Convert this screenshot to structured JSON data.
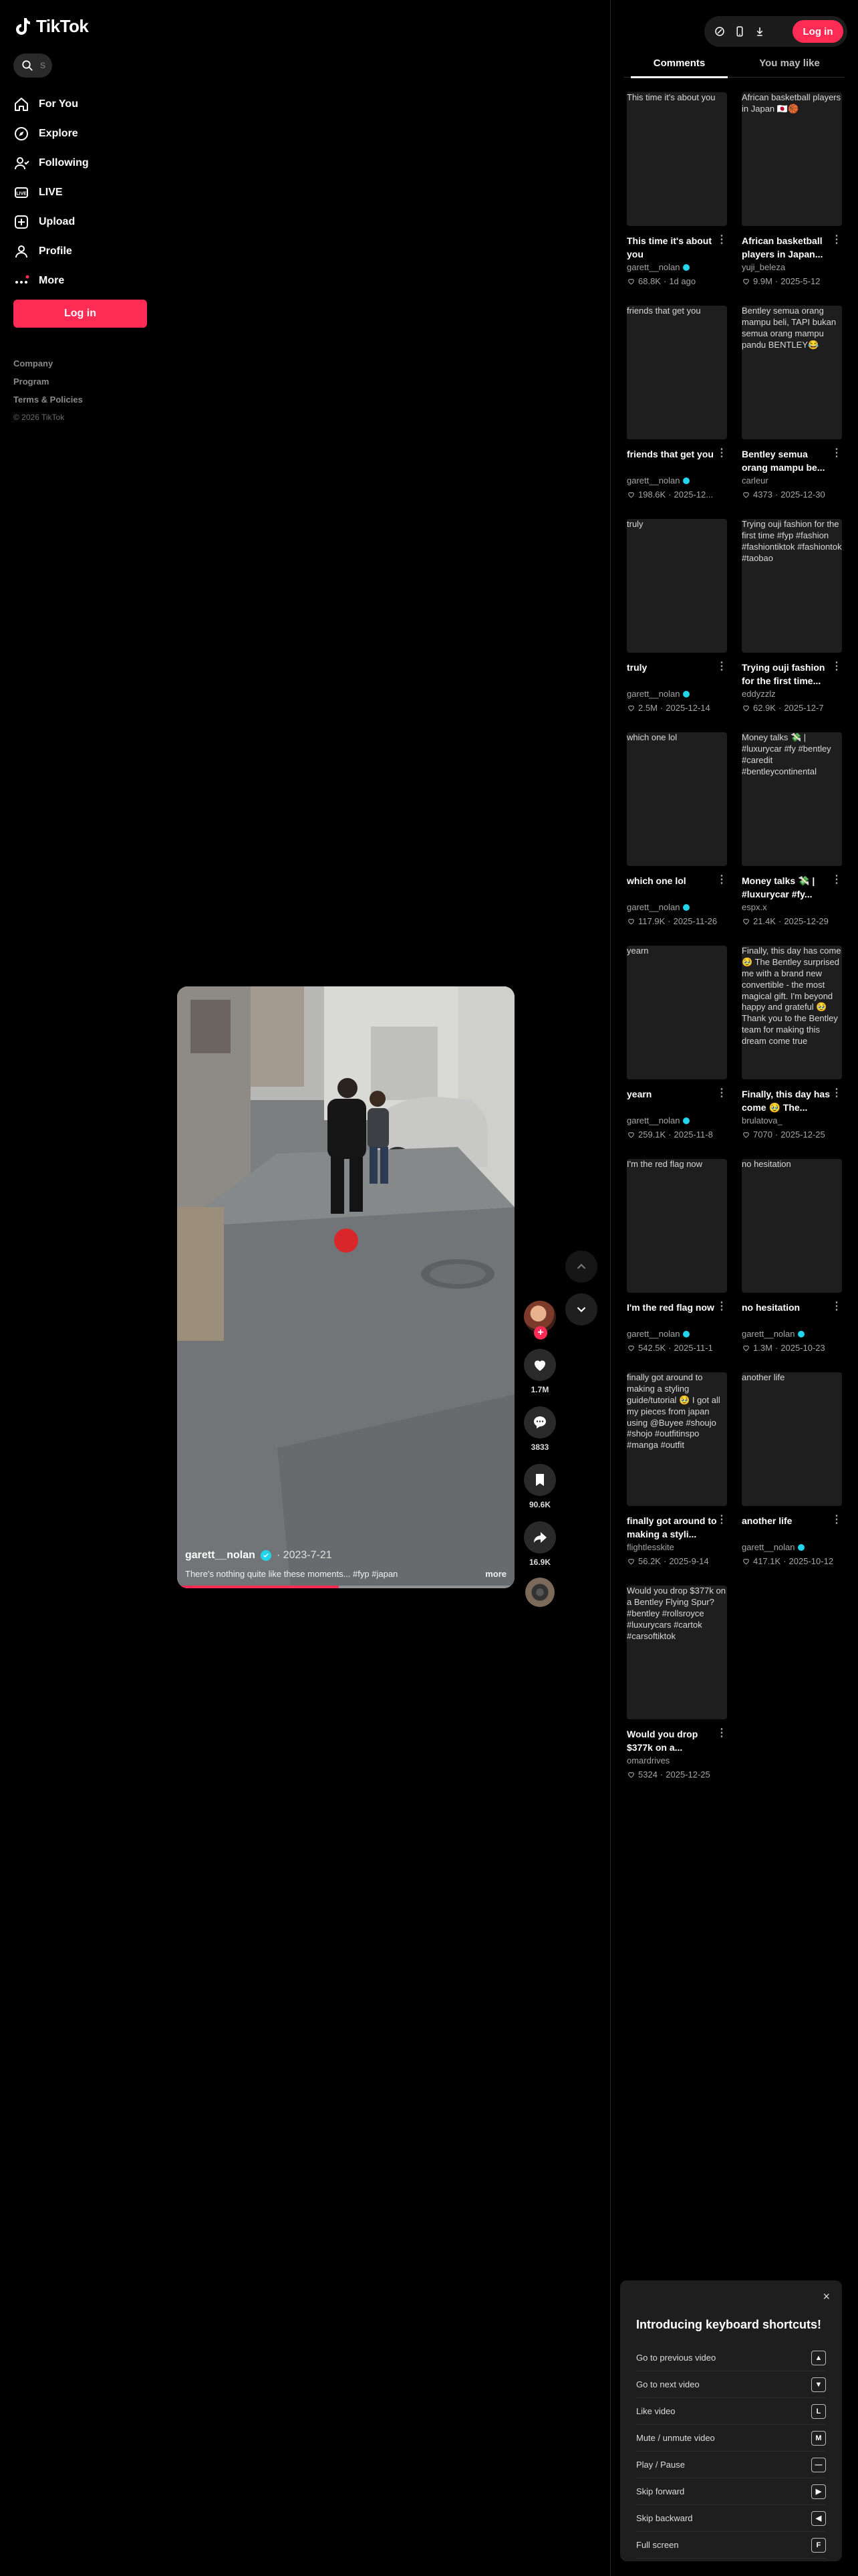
{
  "brand": {
    "name": "TikTok",
    "accent": "#fe2c55",
    "verified_color": "#20d5ec"
  },
  "search": {
    "icon": "search-icon",
    "placeholder": "S"
  },
  "nav": [
    {
      "label": "For You",
      "icon": "home-icon"
    },
    {
      "label": "Explore",
      "icon": "compass-icon"
    },
    {
      "label": "Following",
      "icon": "following-icon"
    },
    {
      "label": "LIVE",
      "icon": "live-icon"
    },
    {
      "label": "Upload",
      "icon": "upload-icon"
    },
    {
      "label": "Profile",
      "icon": "profile-icon"
    },
    {
      "label": "More",
      "icon": "more-icon"
    }
  ],
  "sidebar_login": "Log in",
  "footer": {
    "company": "Company",
    "program": "Program",
    "terms": "Terms & Policies",
    "copyright": "© 2026 TikTok"
  },
  "video": {
    "author": "garett__nolan",
    "date": "2023-7-21",
    "caption": "There's nothing quite like these moments... #fyp #japan",
    "more": "more",
    "progress": 0.48
  },
  "actions": {
    "likes": "1.7M",
    "comments": "3833",
    "saves": "90.6K",
    "shares": "16.9K",
    "follow": "+"
  },
  "top_bar": {
    "login": "Log in"
  },
  "tabs": {
    "comments": "Comments",
    "you_may_like": "You may like"
  },
  "recommended": [
    {
      "thumb": "This time it's about you",
      "title": "This time it's about you",
      "author": "garett__nolan",
      "verified": true,
      "likes": "68.8K",
      "date": "1d ago"
    },
    {
      "thumb": "African basketball players in Japan 🇯🇵🏀",
      "title": "African basketball players in Japan...",
      "author": "yuji_beleza",
      "verified": false,
      "likes": "9.9M",
      "date": "2025-5-12"
    },
    {
      "thumb": "friends that get you",
      "title": "friends that get you",
      "author": "garett__nolan",
      "verified": true,
      "likes": "198.6K",
      "date": "2025-12..."
    },
    {
      "thumb": "Bentley semua orang mampu beli, TAPI bukan semua orang mampu pandu BENTLEY😂",
      "title": "Bentley semua orang mampu be...",
      "author": "carleur",
      "verified": false,
      "likes": "4373",
      "date": "2025-12-30"
    },
    {
      "thumb": "truly",
      "title": "truly",
      "author": "garett__nolan",
      "verified": true,
      "likes": "2.5M",
      "date": "2025-12-14"
    },
    {
      "thumb": "Trying ouji fashion for the first time #fyp #fashion #fashiontiktok #fashiontok #taobao",
      "title": "Trying ouji fashion for the first time...",
      "author": "eddyzzlz",
      "verified": false,
      "likes": "62.9K",
      "date": "2025-12-7"
    },
    {
      "thumb": "which one lol",
      "title": "which one lol",
      "author": "garett__nolan",
      "verified": true,
      "likes": "117.9K",
      "date": "2025-11-26"
    },
    {
      "thumb": "Money talks 💸 | #luxurycar #fy #bentley #caredit #bentleycontinental",
      "title": "Money talks 💸 | #luxurycar #fy...",
      "author": "espx.x",
      "verified": false,
      "likes": "21.4K",
      "date": "2025-12-29"
    },
    {
      "thumb": "yearn",
      "title": "yearn",
      "author": "garett__nolan",
      "verified": true,
      "likes": "259.1K",
      "date": "2025-11-8"
    },
    {
      "thumb": "Finally, this day has come 🥹 The Bentley surprised me with a brand new convertible - the most magical gift. I'm beyond happy and grateful 🥹 Thank you to the Bentley team for making this dream come true",
      "title": "Finally, this day has come 🥹 The...",
      "author": "brulatova_",
      "verified": false,
      "likes": "7070",
      "date": "2025-12-25"
    },
    {
      "thumb": "I'm the red flag now",
      "title": "I'm the red flag now",
      "author": "garett__nolan",
      "verified": true,
      "likes": "542.5K",
      "date": "2025-11-1"
    },
    {
      "thumb": "no hesitation",
      "title": "no hesitation",
      "author": "garett__nolan",
      "verified": true,
      "likes": "1.3M",
      "date": "2025-10-23"
    },
    {
      "thumb": "finally got around to making a styling guide/tutorial 🥹 I got all my pieces from japan using @Buyee #shoujo #shojo #outfitinspo #manga #outfit",
      "title": "finally got around to making a styli...",
      "author": "flightlesskite",
      "verified": false,
      "likes": "56.2K",
      "date": "2025-9-14"
    },
    {
      "thumb": "another life",
      "title": "another life",
      "author": "garett__nolan",
      "verified": true,
      "likes": "417.1K",
      "date": "2025-10-12"
    },
    {
      "thumb": "Would you drop $377k on a Bentley Flying Spur? #bentley #rollsroyce #luxurycars #cartok #carsoftiktok",
      "title": "Would you drop $377k on a...",
      "author": "omardrives",
      "verified": false,
      "likes": "5324",
      "date": "2025-12-25"
    }
  ],
  "keyboard": {
    "close": "×",
    "title": "Introducing keyboard shortcuts!",
    "rows": [
      {
        "label": "Go to previous video",
        "key": "▲"
      },
      {
        "label": "Go to next video",
        "key": "▼"
      },
      {
        "label": "Like video",
        "key": "L"
      },
      {
        "label": "Mute / unmute video",
        "key": "M"
      },
      {
        "label": "Play / Pause",
        "key": "—"
      },
      {
        "label": "Skip forward",
        "key": "▶"
      },
      {
        "label": "Skip backward",
        "key": "◀"
      },
      {
        "label": "Full screen",
        "key": "F"
      }
    ]
  }
}
